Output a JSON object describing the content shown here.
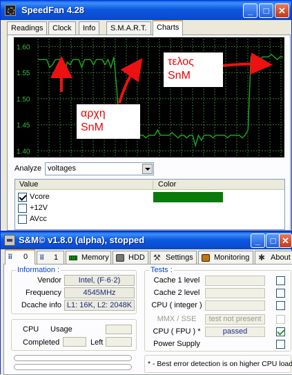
{
  "speedfan": {
    "title": "SpeedFan 4.28",
    "tabs": [
      "Readings",
      "Clock",
      "Info",
      "S.M.A.R.T.",
      "Charts"
    ],
    "active_tab": "Charts",
    "analyze_label": "Analyze",
    "analyze_value": "voltages",
    "list": {
      "col_value": "Value",
      "col_color": "Color",
      "rows": [
        {
          "label": "Vcore",
          "checked": true,
          "color": "#0a7a0a"
        },
        {
          "label": "+12V",
          "checked": false
        },
        {
          "label": "AVcc",
          "checked": false
        }
      ]
    },
    "annotations": {
      "start": [
        "αρχη",
        "SnM"
      ],
      "end": [
        "τελος",
        "SnM"
      ]
    }
  },
  "chart_data": {
    "type": "line",
    "series": [
      {
        "color": "#1fa01f",
        "values": [
          1.575,
          1.575,
          1.575,
          1.575,
          1.56,
          1.565,
          1.575,
          1.575,
          1.575,
          1.545,
          1.57,
          1.565,
          1.575,
          1.575,
          1.575,
          1.56,
          1.575,
          1.575,
          1.575,
          1.565,
          1.575,
          1.575,
          1.575,
          1.565,
          1.575,
          1.56,
          1.58,
          1.52,
          1.435,
          1.425,
          1.43,
          1.43,
          1.425,
          1.435,
          1.43,
          1.43,
          1.43,
          1.425,
          1.43,
          1.43,
          1.43,
          1.44,
          1.43,
          1.43,
          1.43,
          1.43,
          1.435,
          1.43,
          1.425,
          1.43,
          1.43,
          1.425,
          1.43,
          1.43,
          1.41,
          1.43,
          1.42,
          1.43,
          1.43,
          1.43,
          1.425,
          1.43,
          1.43,
          1.43,
          1.43,
          1.425,
          1.43,
          1.43,
          1.43,
          1.43,
          1.425,
          1.43,
          1.44,
          1.58,
          1.58,
          1.575,
          1.575,
          1.58,
          1.58,
          1.58,
          1.585,
          1.58,
          1.575,
          1.58,
          1.58
        ]
      }
    ],
    "yticks": [
      "1.60",
      "1.55",
      "1.50",
      "1.45",
      "1.40"
    ],
    "ylim": [
      1.39,
      1.615
    ],
    "grid": true,
    "background": "#000000",
    "grid_color": "#3a7a3a"
  },
  "sm": {
    "title": "S&M© v1.8.0 (alpha), stopped",
    "tabs": [
      {
        "label": "0",
        "icon": "sm-icon"
      },
      {
        "label": "1",
        "icon": "sm-icon"
      },
      {
        "label": "Memory",
        "icon": "memory-icon"
      },
      {
        "label": "HDD",
        "icon": "hdd-icon"
      },
      {
        "label": "Settings",
        "icon": "wrench-icon"
      },
      {
        "label": "Monitoring",
        "icon": "monitor-icon"
      },
      {
        "label": "About",
        "icon": "about-icon"
      }
    ],
    "information": {
      "legend": "Information :",
      "vendor_label": "Vendor",
      "vendor_value": "Intel,  (F·6·2)",
      "frequency_label": "Frequency",
      "frequency_value": "4545MHz",
      "dcache_label": "Dcache info",
      "dcache_value": "L1: 16K, L2: 2048K"
    },
    "cpu": {
      "cpu_label": "CPU",
      "usage_label": "Usage",
      "completed_label": "Completed",
      "left_label": "Left"
    },
    "tests": {
      "legend": "Tests :",
      "rows": [
        {
          "label": "Cache 1 level",
          "value": "",
          "enabled": true,
          "checked": false
        },
        {
          "label": "Cache 2 level",
          "value": "",
          "enabled": true,
          "checked": false
        },
        {
          "label": "CPU ( integer )",
          "value": "",
          "enabled": true,
          "checked": false
        },
        {
          "label": "MMX / SSE",
          "value": "test not present",
          "enabled": false,
          "checked": false
        },
        {
          "label": "CPU ( FPU ) *",
          "value": "passed",
          "enabled": true,
          "checked": true
        },
        {
          "label": "Power Supply",
          "value": "",
          "enabled": true,
          "checked": false
        }
      ]
    },
    "note": "* - Best error detection is on higher CPU load"
  }
}
